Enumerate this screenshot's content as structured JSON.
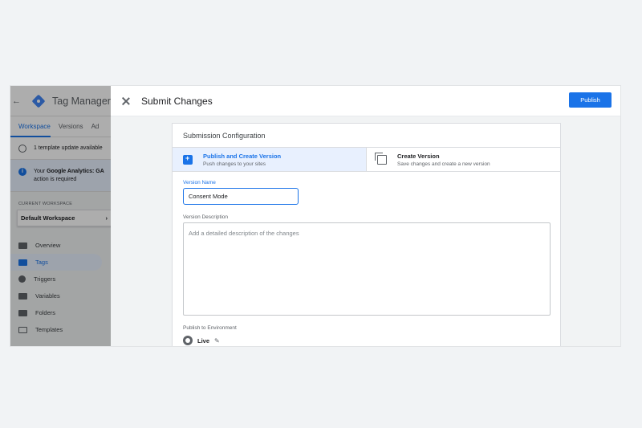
{
  "app": {
    "title": "Tag Manager",
    "tabs": [
      {
        "label": "Workspace"
      },
      {
        "label": "Versions"
      },
      {
        "label": "Ad"
      }
    ],
    "notice": "1 template update available",
    "info": {
      "prefix": "Your ",
      "strong": "Google Analytics: GA",
      "suffix": "action is required"
    },
    "current_workspace_label": "CURRENT WORKSPACE",
    "workspace_name": "Default Workspace",
    "nav": [
      {
        "label": "Overview"
      },
      {
        "label": "Tags"
      },
      {
        "label": "Triggers"
      },
      {
        "label": "Variables"
      },
      {
        "label": "Folders"
      },
      {
        "label": "Templates"
      }
    ]
  },
  "modal": {
    "title": "Submit Changes",
    "publish_label": "Publish",
    "card_title": "Submission Configuration",
    "options": [
      {
        "title": "Publish and Create Version",
        "subtitle": "Push changes to your sites"
      },
      {
        "title": "Create Version",
        "subtitle": "Save changes and create a new version"
      }
    ],
    "version_name_label": "Version Name",
    "version_name_value": "Consent Mode",
    "version_description_label": "Version Description",
    "version_description_placeholder": "Add a detailed description of the changes",
    "environment_label": "Publish to Environment",
    "environment_name": "Live"
  },
  "colors": {
    "accent": "#1a73e8"
  }
}
